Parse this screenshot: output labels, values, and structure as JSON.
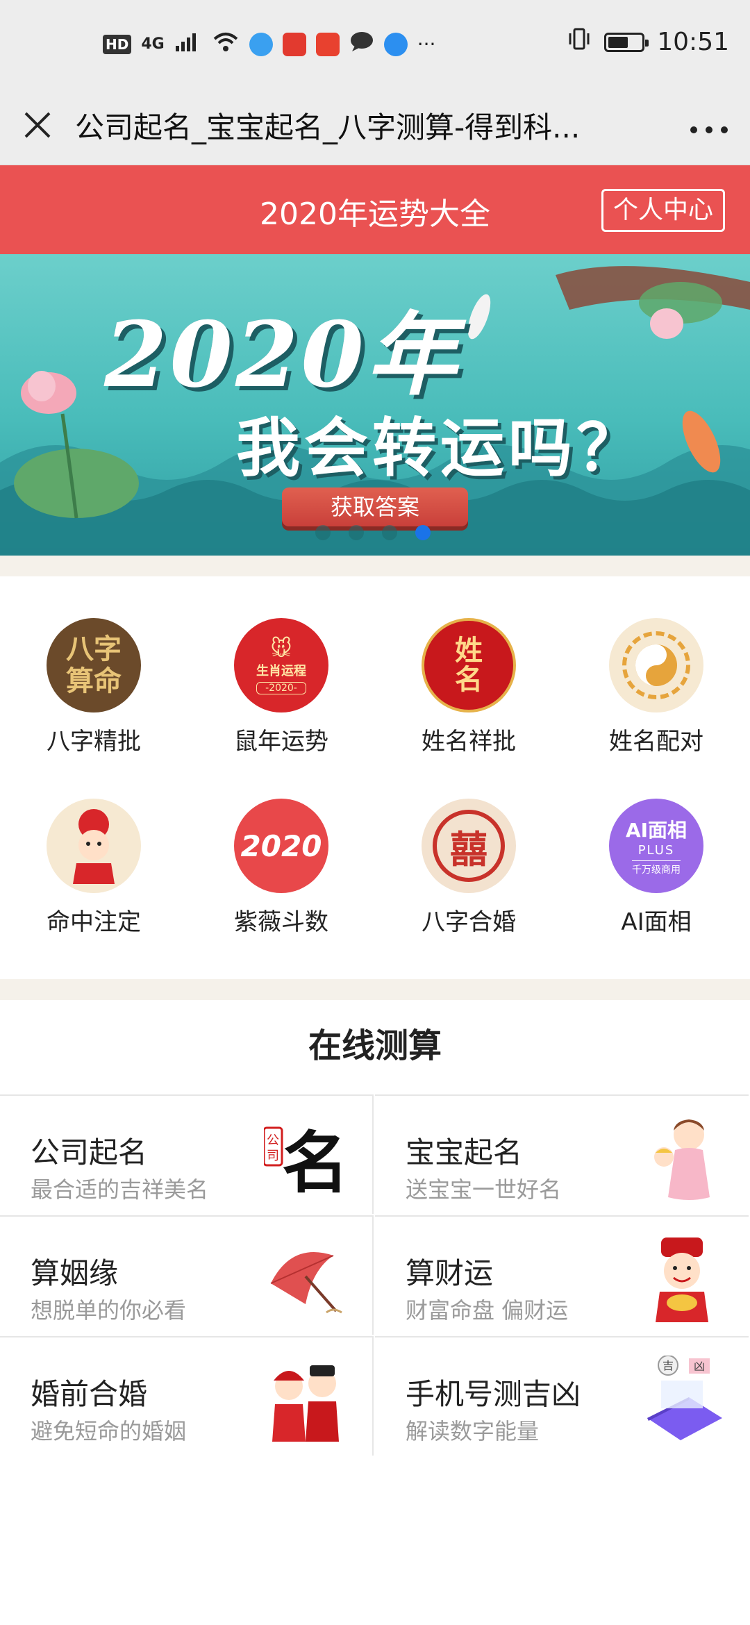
{
  "status_bar": {
    "network": "4G",
    "hd": "HD",
    "time": "10:51",
    "more": "···",
    "apps": [
      {
        "name": "网易",
        "color": "#e23a2f"
      },
      {
        "name": "头条",
        "color": "#e8412f"
      }
    ]
  },
  "titlebar": {
    "title": "公司起名_宝宝起名_八字测算-得到科...",
    "close": "✕",
    "more": "•••"
  },
  "header": {
    "title": "2020年运势大全",
    "personal_center": "个人中心"
  },
  "banner": {
    "headline": "2020年",
    "subline": "我会转运吗？",
    "button": "获取答案",
    "slides": 4,
    "active_slide": 4
  },
  "icons": [
    {
      "label": "八字精批",
      "glyph": "八字\n算命",
      "bg": "#6b4a2a",
      "fg": "#e8c477",
      "icon": "bazi-icon"
    },
    {
      "label": "鼠年运势",
      "glyph": "生肖运程",
      "bg": "#d8262a",
      "fg": "#ffe6a6",
      "icon": "rat-year-icon"
    },
    {
      "label": "姓名祥批",
      "glyph": "姓名",
      "bg": "#c8181c",
      "fg": "#ffd98a",
      "icon": "name-icon"
    },
    {
      "label": "姓名配对",
      "glyph": "☯",
      "bg": "#f6e9d2",
      "fg": "#e6a43c",
      "icon": "name-match-icon"
    },
    {
      "label": "命中注定",
      "glyph": "♔",
      "bg": "#f6e9d2",
      "fg": "#d8262a",
      "icon": "destiny-icon"
    },
    {
      "label": "紫薇斗数",
      "glyph": "2020",
      "bg": "#e8484a",
      "fg": "#ffffff",
      "icon": "ziwei-icon"
    },
    {
      "label": "八字合婚",
      "glyph": "囍",
      "bg": "#f3e2cf",
      "fg": "#c8322a",
      "icon": "marriage-icon"
    },
    {
      "label": "AI面相",
      "glyph": "AI面相",
      "sub": "PLUS",
      "sub2": "千万级商用",
      "bg": "#9b6ae8",
      "fg": "#ffffff",
      "icon": "ai-face-icon"
    }
  ],
  "online": {
    "title": "在线测算",
    "cards": [
      {
        "title": "公司起名",
        "sub": "最合适的吉祥美名",
        "icon": "company-name-icon"
      },
      {
        "title": "宝宝起名",
        "sub": "送宝宝一世好名",
        "icon": "baby-name-icon"
      },
      {
        "title": "算姻缘",
        "sub": "想脱单的你必看",
        "icon": "umbrella-icon"
      },
      {
        "title": "算财运",
        "sub": "财富命盘 偏财运",
        "icon": "wealth-god-icon"
      },
      {
        "title": "婚前合婚",
        "sub": "避免短命的婚姻",
        "icon": "couple-icon"
      },
      {
        "title": "手机号测吉凶",
        "sub": "解读数字能量",
        "icon": "phone-icon"
      }
    ]
  },
  "colors": {
    "header_red": "#ea5252",
    "banner_teal": "#49bcba",
    "active_dot": "#1a73e8"
  }
}
